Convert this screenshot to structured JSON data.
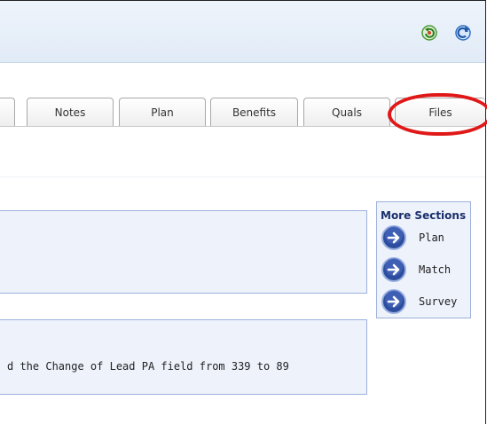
{
  "toolbar": {
    "icons": [
      "refresh-green-icon",
      "refresh-blue-icon"
    ]
  },
  "tabs": [
    {
      "label": ""
    },
    {
      "label": "Notes"
    },
    {
      "label": "Plan"
    },
    {
      "label": "Benefits"
    },
    {
      "label": "Quals"
    },
    {
      "label": "Files"
    }
  ],
  "highlighted_tab": "Files",
  "highlight_color": "#e01818",
  "panels": {
    "panel1_text": "",
    "panel2_text": "d the Change of Lead PA field from 339 to 89"
  },
  "more_sections": {
    "title": "More Sections",
    "items": [
      {
        "label": "Plan",
        "icon": "arrow-right-icon"
      },
      {
        "label": "Match",
        "icon": "arrow-right-icon"
      },
      {
        "label": "Survey",
        "icon": "arrow-right-icon"
      }
    ]
  }
}
